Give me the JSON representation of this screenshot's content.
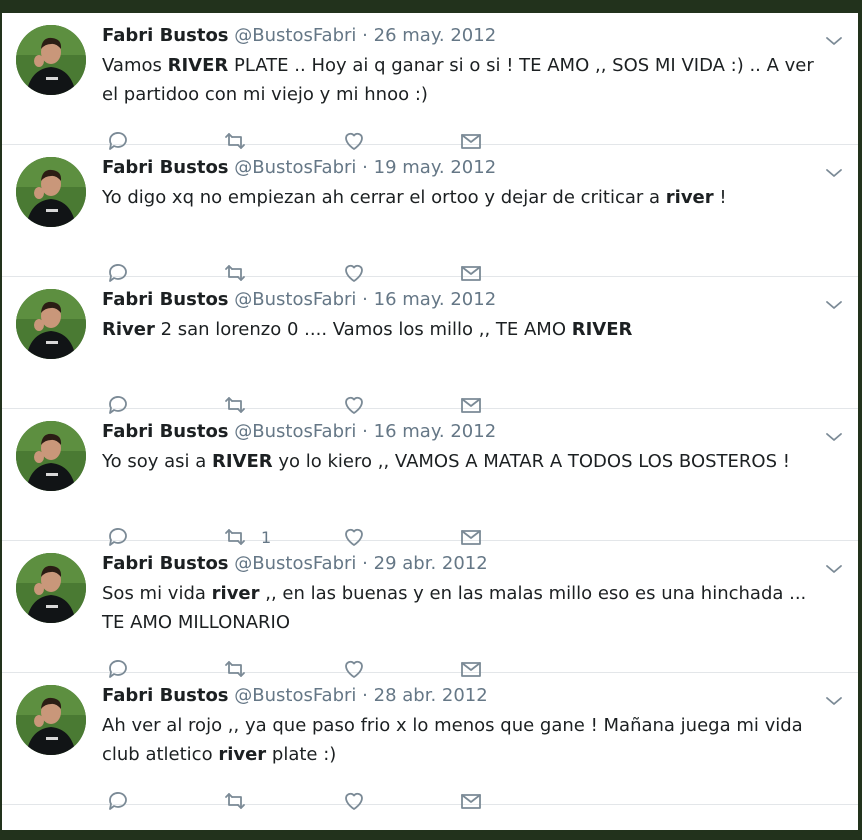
{
  "tweets": [
    {
      "name": "Fabri Bustos",
      "handle": "@BustosFabri",
      "date": "26 may. 2012",
      "segments": [
        {
          "t": "Vamos "
        },
        {
          "t": "RIVER",
          "b": true
        },
        {
          "t": " PLATE .. Hoy ai q ganar si o si ! TE AMO ,, SOS MI VIDA :) .. A ver el partidoo con mi viejo y mi hnoo :)"
        }
      ],
      "retweets": ""
    },
    {
      "name": "Fabri Bustos",
      "handle": "@BustosFabri",
      "date": "19 may. 2012",
      "segments": [
        {
          "t": "Yo digo xq no empiezan ah cerrar el ortoo y dejar de criticar a "
        },
        {
          "t": "river",
          "b": true
        },
        {
          "t": " !"
        }
      ],
      "retweets": ""
    },
    {
      "name": "Fabri Bustos",
      "handle": "@BustosFabri",
      "date": "16 may. 2012",
      "segments": [
        {
          "t": "River",
          "b": true
        },
        {
          "t": " 2 san lorenzo 0 .... Vamos los millo ,, TE AMO "
        },
        {
          "t": "RIVER",
          "b": true
        }
      ],
      "retweets": ""
    },
    {
      "name": "Fabri Bustos",
      "handle": "@BustosFabri",
      "date": "16 may. 2012",
      "segments": [
        {
          "t": "Yo soy asi a "
        },
        {
          "t": "RIVER",
          "b": true
        },
        {
          "t": " yo lo kiero ,, VAMOS A MATAR A TODOS LOS BOSTEROS !"
        }
      ],
      "retweets": "1"
    },
    {
      "name": "Fabri Bustos",
      "handle": "@BustosFabri",
      "date": "29 abr. 2012",
      "segments": [
        {
          "t": "Sos mi vida "
        },
        {
          "t": "river",
          "b": true
        },
        {
          "t": " ,, en las buenas y en las malas millo eso es una hinchada ... TE AMO MILLONARIO"
        }
      ],
      "retweets": ""
    },
    {
      "name": "Fabri Bustos",
      "handle": "@BustosFabri",
      "date": "28 abr. 2012",
      "segments": [
        {
          "t": "Ah ver al rojo ,, ya que paso frio x lo menos que gane ! Mañana juega mi vida club atletico "
        },
        {
          "t": "river",
          "b": true
        },
        {
          "t": " plate :)"
        }
      ],
      "retweets": ""
    }
  ],
  "separator": "·",
  "icons": {
    "reply": "reply-icon",
    "retweet": "retweet-icon",
    "like": "heart-icon",
    "dm": "envelope-icon",
    "more": "chevron-down-icon"
  },
  "colors": {
    "frame": "#22321c",
    "text": "#1c2022",
    "secondary": "#657786",
    "icon": "#7b8a96"
  }
}
